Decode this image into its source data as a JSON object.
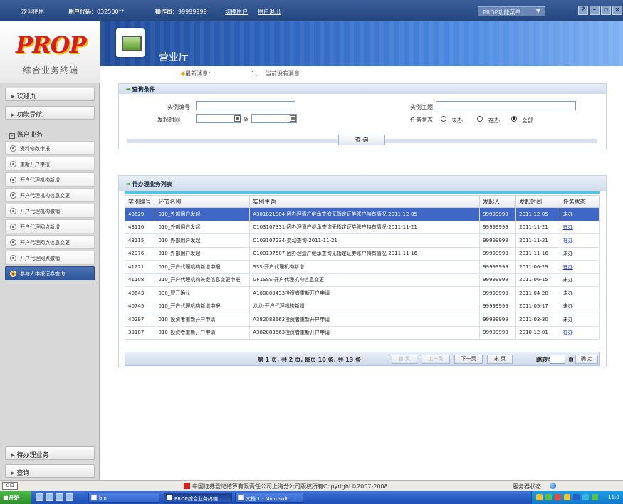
{
  "topbar": {
    "welcome": "欢迎使用",
    "user_code_label": "用户代码：",
    "user_code": "032500**",
    "operator_label": "操作员：",
    "operator": "99999999",
    "switch_user": "切换用户",
    "logout": "用户退出",
    "menu_select": "PROP功能菜单",
    "win_buttons": [
      "?",
      "–",
      "▫",
      "×"
    ]
  },
  "sidebar": {
    "logo": "PROP",
    "subtitle": "综合业务终端",
    "top_buttons": [
      "欢迎页",
      "功能导航"
    ],
    "section": "账户业务",
    "items": [
      "资料修改申报",
      "重新开户申报",
      "开户代理机构新增",
      "开户代理机构信息变更",
      "开户代理机构撤销",
      "开户代理网点新增",
      "开户代理网点信息变更",
      "开户代理网点撤销",
      "参与人申报证券查询"
    ],
    "active_index": 8,
    "bottom_buttons": [
      "待办理业务",
      "查询"
    ]
  },
  "banner": {
    "title": "营业厅"
  },
  "news": {
    "label": "最新消息：",
    "num": "1、",
    "message": "当前没有消息"
  },
  "query": {
    "title": "查询条件",
    "instance_no_label": "实例编号",
    "instance_no_value": "",
    "subject_label": "实例主题",
    "subject_value": "",
    "time_label": "发起时间",
    "to_label": "至",
    "status_label": "任务状态",
    "status_options": [
      "未办",
      "在办",
      "全部"
    ],
    "status_selected": 2,
    "query_button": "查 询"
  },
  "list": {
    "title": "待办理业务列表",
    "columns": [
      "实例编号",
      "环节名称",
      "实例主题",
      "发起人",
      "发起时间",
      "任务状态"
    ],
    "rows": [
      [
        "43529",
        "010_外部用户发起",
        "A301821004-因办理遗产继承查询无指定证券账户持有情况-2011-12-05",
        "99999999",
        "2011-12-05",
        "未办"
      ],
      [
        "43116",
        "010_外部用户发起",
        "C103107331-因办理遗产继承查询无指定证券账户持有情况-2011-11-21",
        "99999999",
        "2011-11-21",
        "在办"
      ],
      [
        "43115",
        "010_外部用户发起",
        "C103107234-变动查询-2011-11-21",
        "99999999",
        "2011-11-21",
        "在办"
      ],
      [
        "42976",
        "010_外部用户发起",
        "C100137507-因办理遗产继承查询无指定证券账户持有情况-2011-11-16",
        "99999999",
        "2011-11-16",
        "未办"
      ],
      [
        "41221",
        "010_开户代理机构新增申报",
        "SSS-开户代理机构新增",
        "99999999",
        "2011-06-29",
        "在办"
      ],
      [
        "41108",
        "210_开户代理机构关键信息变更申报",
        "GF1SSS-开户代理机构信息变更",
        "99999999",
        "2011-06-15",
        "未办"
      ],
      [
        "40643",
        "030_冒开确认",
        "A100000433投资者重新开户申请",
        "99999999",
        "2011-04-28",
        "未办"
      ],
      [
        "40745",
        "010_开户代理机构新增申报",
        "龙龙-开户代理机构新增",
        "99999999",
        "2011-05-17",
        "未办"
      ],
      [
        "40297",
        "010_投资者重新开户申请",
        "A382083663投资者重新开户申请",
        "99999999",
        "2011-03-30",
        "未办"
      ],
      [
        "39187",
        "010_投资者重新开户申请",
        "A382083663投资者重新开户申请",
        "99999999",
        "2010-12-01",
        "在办"
      ]
    ],
    "selected_row": 0,
    "pager_info": "第 1 页, 共 2 页, 每页 10 条, 共 13 条",
    "pager_buttons": [
      "首 页",
      "上一页",
      "下一页",
      "末 页"
    ],
    "jump_label": "跳转至第",
    "jump_value": "",
    "page_unit": "页",
    "confirm": "确 定"
  },
  "status": {
    "copyright": "中国证券登记结算有限责任公司上海分公司版权所有Copyright©2007-2008",
    "server_label": "服务器状态："
  },
  "taskbar": {
    "start": "开始",
    "tasks": [
      "bin",
      "PROP综合业务终端",
      "文档 1 - Microsoft ..."
    ],
    "clock": "11:0"
  }
}
